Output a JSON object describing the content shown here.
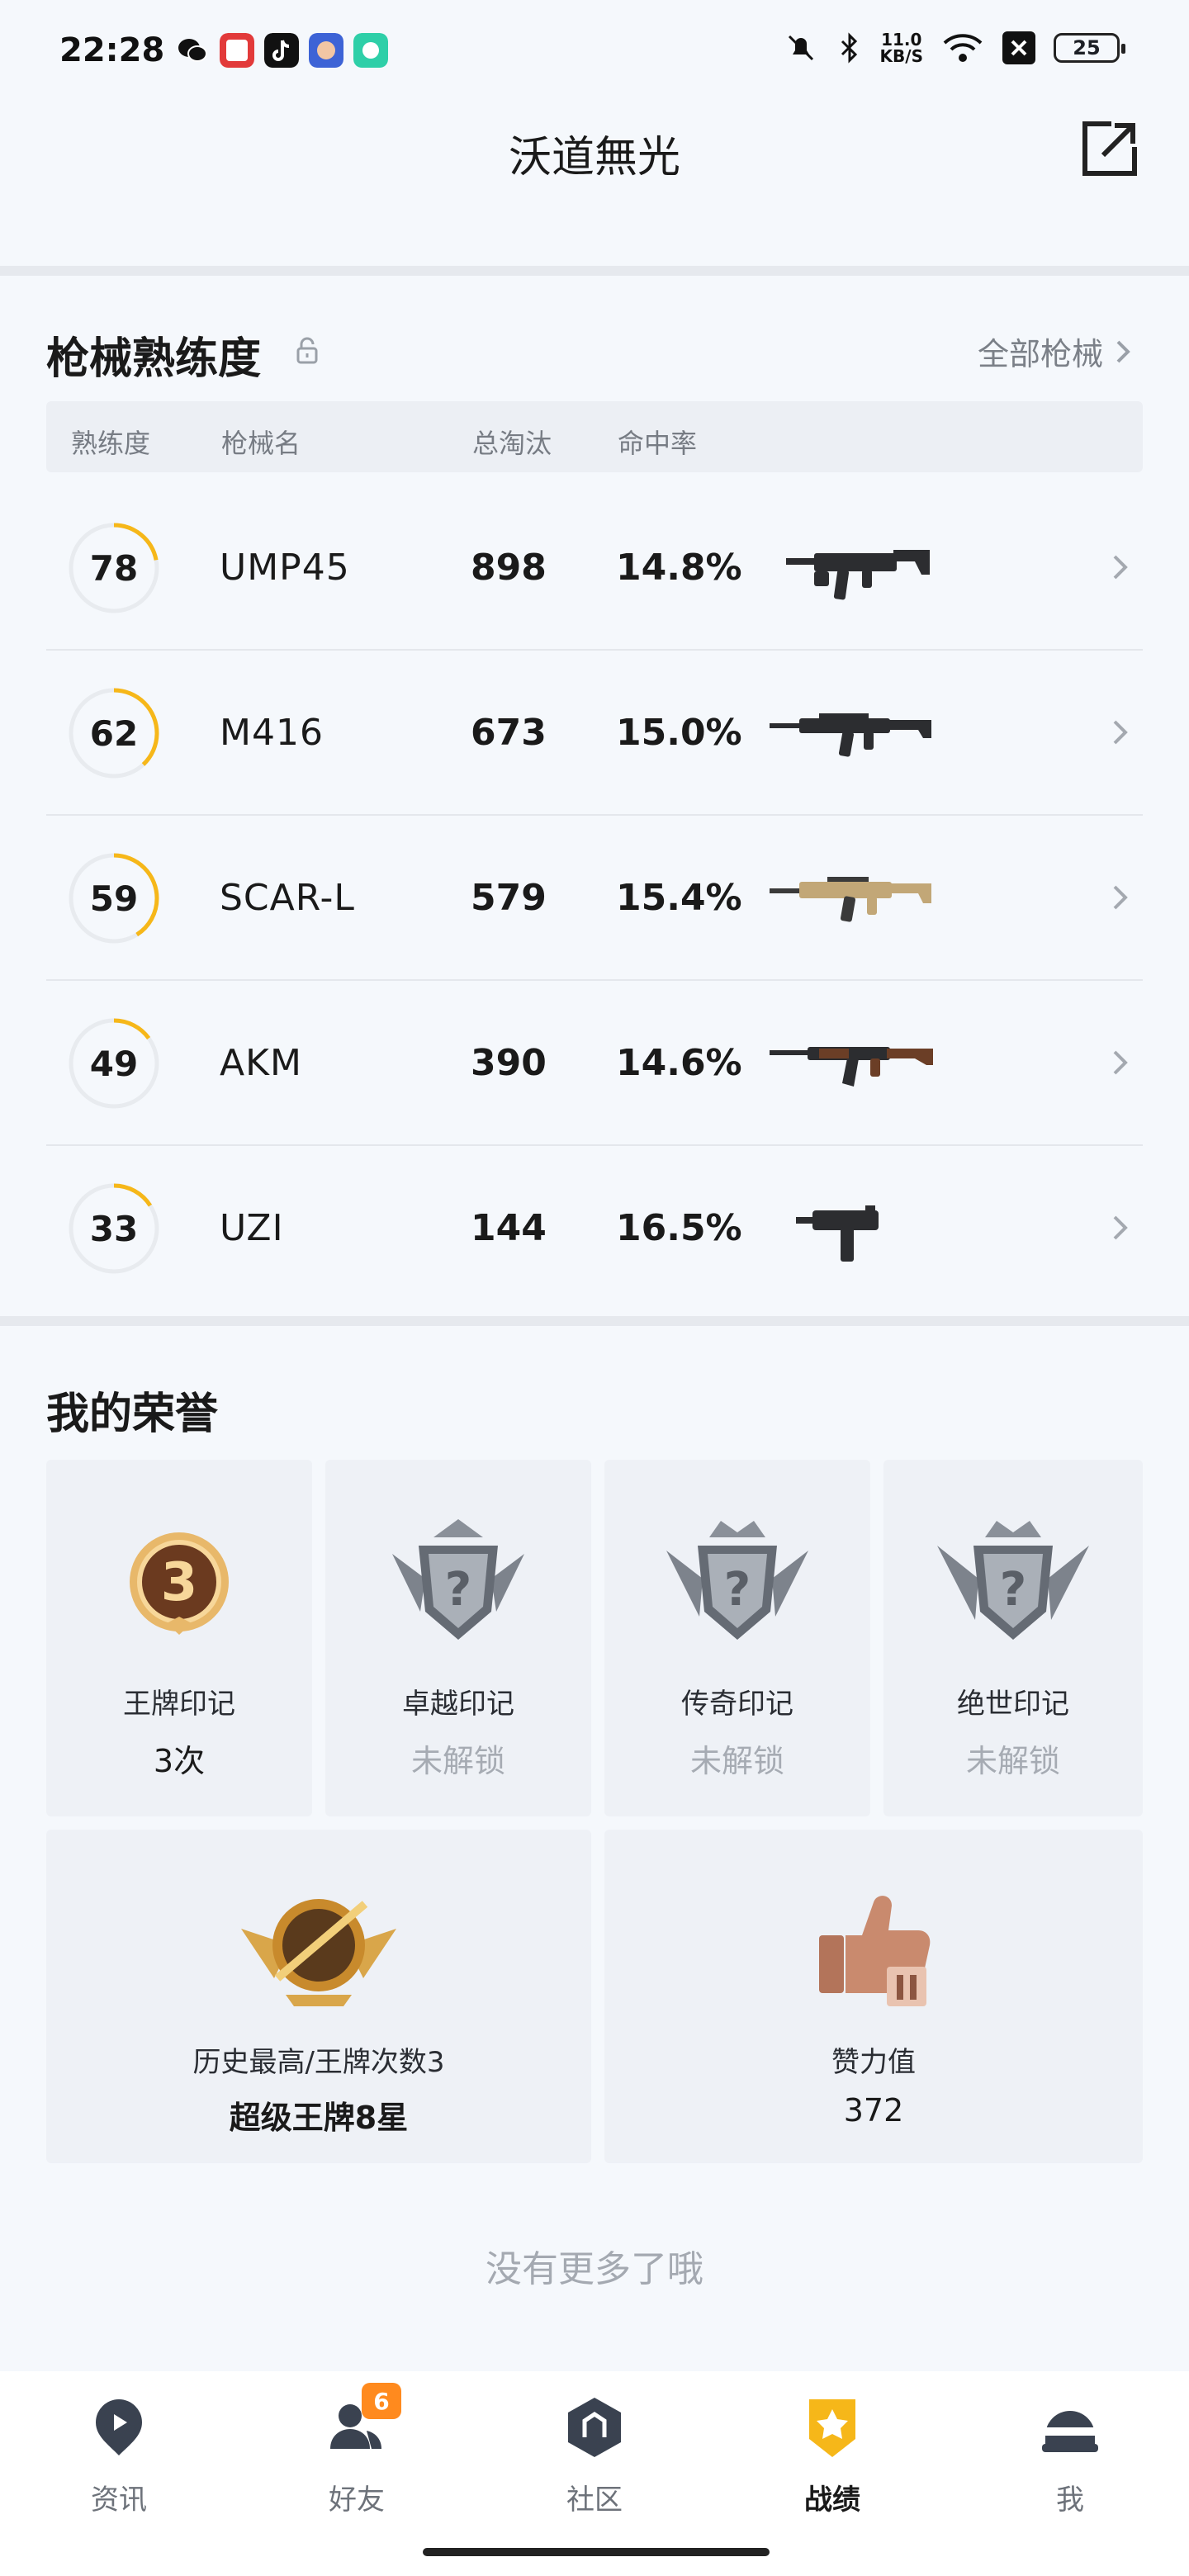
{
  "status_bar": {
    "time": "22:28",
    "net_speed_value": "11.0",
    "net_speed_unit": "KB/S",
    "battery": "25",
    "icons": [
      "wechat-icon",
      "app-icon",
      "tiktok-icon",
      "game-icon",
      "chat-app-icon",
      "mute-icon",
      "bluetooth-icon",
      "wifi-icon",
      "x-app-icon"
    ]
  },
  "header": {
    "title": "沃道無光",
    "share_icon": "external-link-icon"
  },
  "weapons": {
    "title": "枪械熟练度",
    "all_label": "全部枪械",
    "columns": [
      "熟练度",
      "枪械名",
      "总淘汰",
      "命中率"
    ],
    "rows": [
      {
        "level": "78",
        "progress": 0.22,
        "name": "UMP45",
        "kills": "898",
        "rate": "14.8%",
        "weapon_icon": "smg-icon"
      },
      {
        "level": "62",
        "progress": 0.38,
        "name": "M416",
        "kills": "673",
        "rate": "15.0%",
        "weapon_icon": "rifle-icon"
      },
      {
        "level": "59",
        "progress": 0.41,
        "name": "SCAR-L",
        "kills": "579",
        "rate": "15.4%",
        "weapon_icon": "rifle-tan-icon"
      },
      {
        "level": "49",
        "progress": 0.15,
        "name": "AKM",
        "kills": "390",
        "rate": "14.6%",
        "weapon_icon": "akm-icon"
      },
      {
        "level": "33",
        "progress": 0.16,
        "name": "UZI",
        "kills": "144",
        "rate": "16.5%",
        "weapon_icon": "uzi-icon"
      }
    ]
  },
  "honor": {
    "title": "我的荣誉",
    "badges": [
      {
        "label": "王牌印记",
        "value": "3次",
        "badge_number": "3",
        "locked": false
      },
      {
        "label": "卓越印记",
        "value": "未解锁",
        "locked": true
      },
      {
        "label": "传奇印记",
        "value": "未解锁",
        "locked": true
      },
      {
        "label": "绝世印记",
        "value": "未解锁",
        "locked": true
      }
    ],
    "highest": {
      "label": "历史最高/王牌次数3",
      "value": "超级王牌8星"
    },
    "likes": {
      "label": "赞力值",
      "value": "372"
    }
  },
  "footer": {
    "no_more": "没有更多了哦"
  },
  "colors": {
    "accent": "#f6b719",
    "background": "#f5f8fc"
  },
  "nav": {
    "items": [
      {
        "label": "资讯",
        "icon": "news-icon",
        "active": false
      },
      {
        "label": "好友",
        "icon": "friends-icon",
        "badge": "6",
        "active": false
      },
      {
        "label": "社区",
        "icon": "community-icon",
        "active": false
      },
      {
        "label": "战绩",
        "icon": "record-icon",
        "active": true
      },
      {
        "label": "我",
        "icon": "profile-icon",
        "active": false
      }
    ]
  }
}
